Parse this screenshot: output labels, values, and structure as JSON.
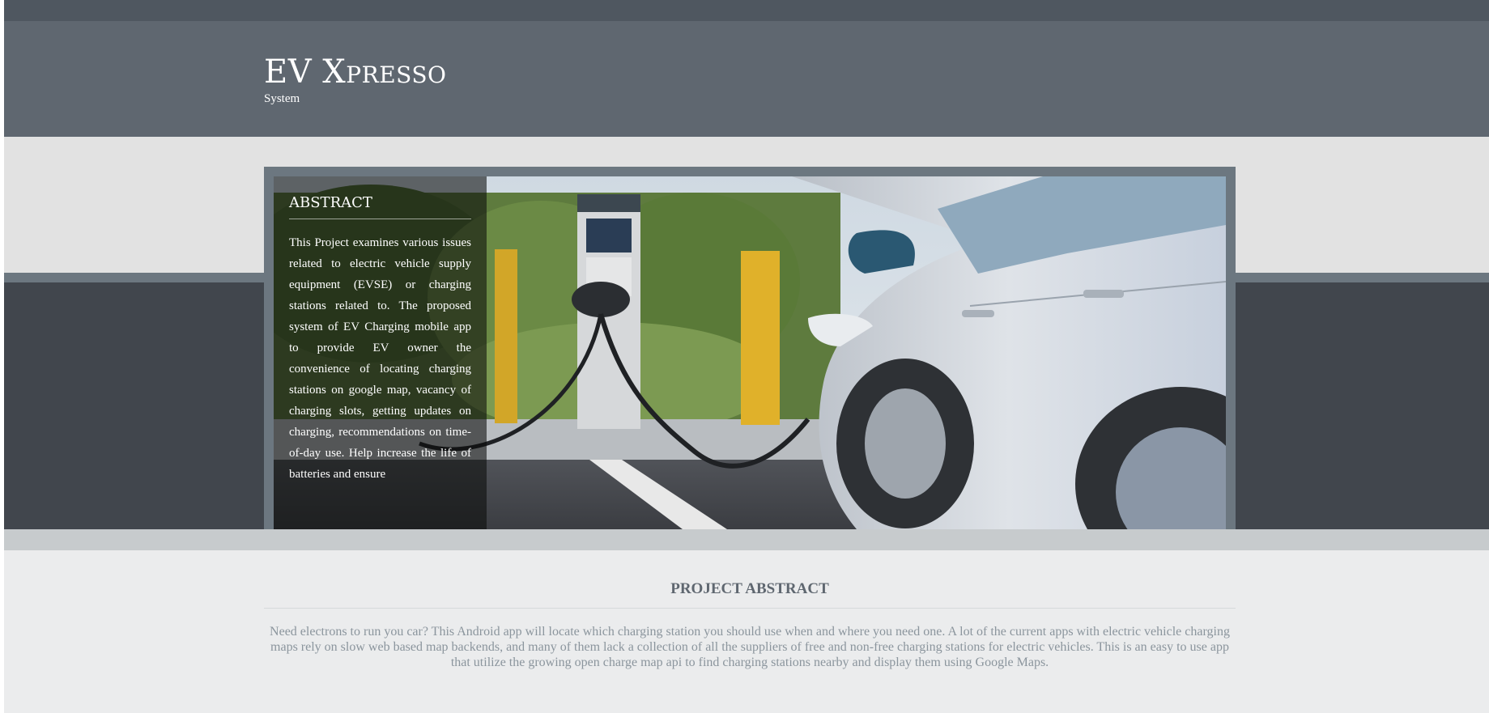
{
  "header": {
    "title": "EV Xpresso",
    "subtitle": "System"
  },
  "hero": {
    "abstract_heading": "ABSTRACT",
    "abstract_text": "This Project examines various issues related to electric vehicle supply equipment (EVSE) or charging stations related to. The proposed system of EV Charging mobile app to provide EV owner the convenience of locating charging stations on google map, vacancy of charging slots, getting updates on charging, recommendations on time-of-day use. Help increase the life of batteries and ensure"
  },
  "project_abstract": {
    "title": "PROJECT ABSTRACT",
    "body": "Need electrons to run you car? This Android app will locate which charging station you should use when and where you need one. A lot of the current apps with electric vehicle charging maps rely on slow web based map backends, and many of them lack a collection of all the suppliers of free and non-free charging stations for electric vehicles. This is an easy to use app that utilize the growing open charge map api to find charging stations nearby and display them using Google Maps."
  },
  "colors": {
    "header_bg": "#5f6770",
    "dark_band": "#41464d",
    "frame": "#6c7780",
    "page_bg": "#ebeced"
  },
  "icons": {
    "hero_image": "ev-charging-photo"
  }
}
